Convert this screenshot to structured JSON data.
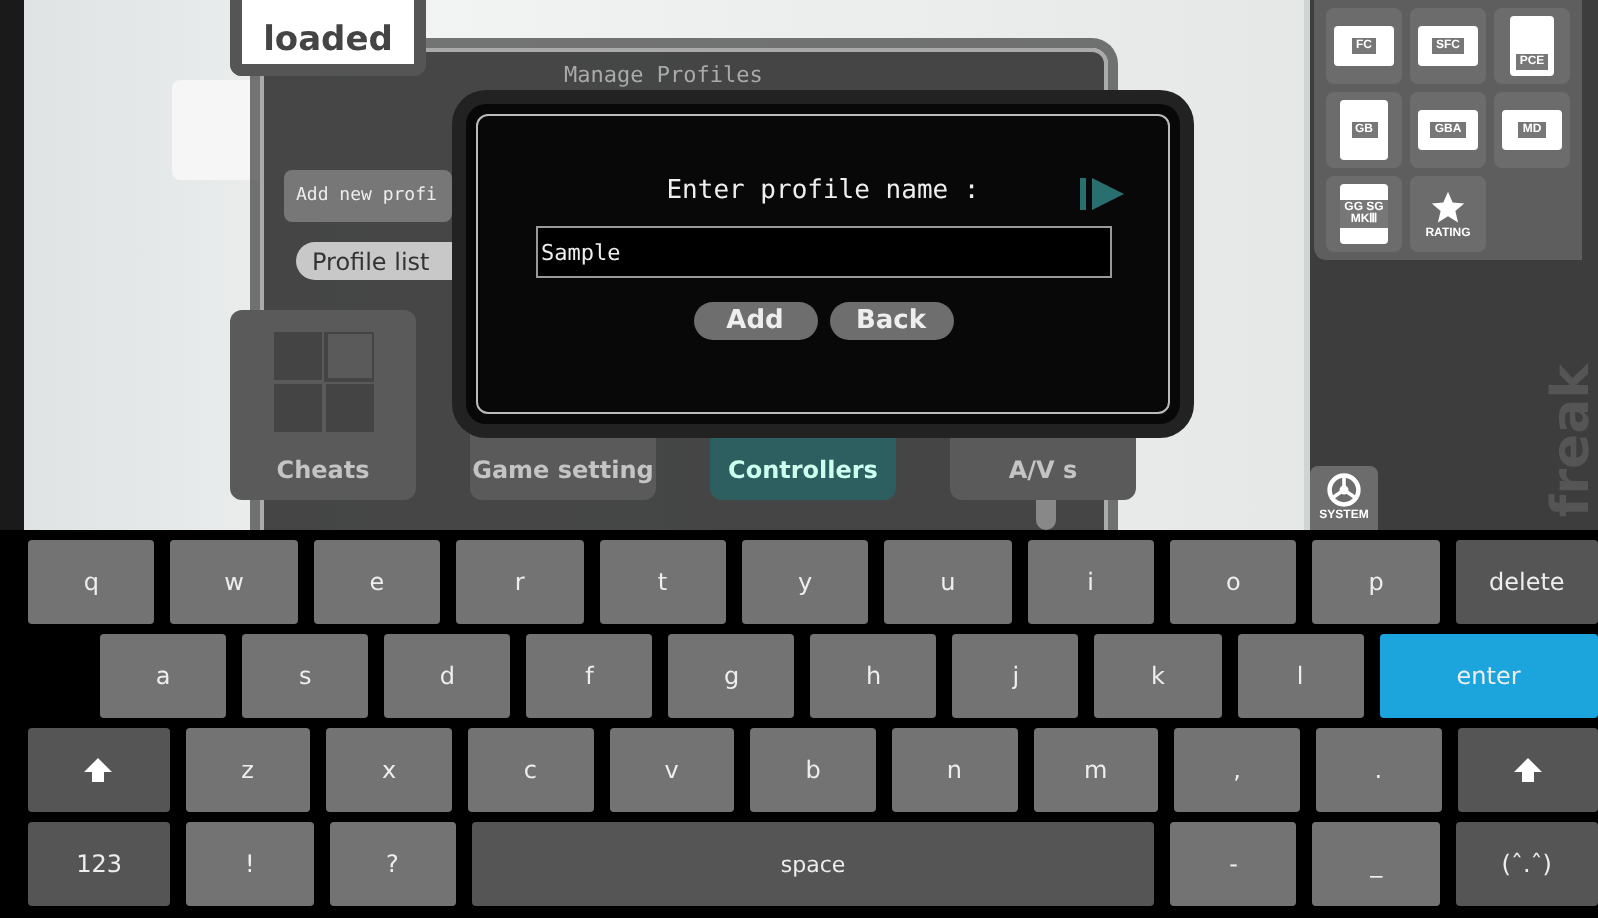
{
  "background": {
    "game_card": "loaded"
  },
  "manage_dialog": {
    "title": "Manage Profiles",
    "add_item": "Add new profi",
    "list_item": "Profile list"
  },
  "tiles": [
    {
      "label": "Cheats",
      "selected": false
    },
    {
      "label": "Game setting",
      "selected": false
    },
    {
      "label": "Controllers",
      "selected": true
    },
    {
      "label": "A/V s",
      "selected": false
    }
  ],
  "prompt": {
    "title": "Enter profile name :",
    "value": "Sample",
    "buttons": [
      "Add",
      "Back"
    ]
  },
  "sidebar": {
    "consoles": [
      {
        "label": "FC",
        "kind": "wide"
      },
      {
        "label": "SFC",
        "kind": "wide"
      },
      {
        "label": "PCE",
        "kind": "card"
      },
      {
        "label": "GB",
        "kind": "tall"
      },
      {
        "label": "GBA",
        "kind": "wide"
      },
      {
        "label": "MD",
        "kind": "wide"
      },
      {
        "label": "GG SG MKⅢ",
        "kind": "tall"
      },
      {
        "label": "RATING",
        "kind": "rating"
      }
    ],
    "system": "SYSTEM",
    "logo": "freak"
  },
  "keyboard": [
    [
      {
        "label": "q",
        "kind": "char"
      },
      {
        "label": "w",
        "kind": "char"
      },
      {
        "label": "e",
        "kind": "char"
      },
      {
        "label": "r",
        "kind": "char"
      },
      {
        "label": "t",
        "kind": "char"
      },
      {
        "label": "y",
        "kind": "char"
      },
      {
        "label": "u",
        "kind": "char"
      },
      {
        "label": "i",
        "kind": "char"
      },
      {
        "label": "o",
        "kind": "char"
      },
      {
        "label": "p",
        "kind": "char"
      },
      {
        "label": "delete",
        "kind": "action"
      }
    ],
    [
      {
        "label": "a",
        "kind": "char"
      },
      {
        "label": "s",
        "kind": "char"
      },
      {
        "label": "d",
        "kind": "char"
      },
      {
        "label": "f",
        "kind": "char"
      },
      {
        "label": "g",
        "kind": "char"
      },
      {
        "label": "h",
        "kind": "char"
      },
      {
        "label": "j",
        "kind": "char"
      },
      {
        "label": "k",
        "kind": "char"
      },
      {
        "label": "l",
        "kind": "char"
      },
      {
        "label": "enter",
        "kind": "enter"
      }
    ],
    [
      {
        "kind": "shift"
      },
      {
        "label": "z",
        "kind": "char"
      },
      {
        "label": "x",
        "kind": "char"
      },
      {
        "label": "c",
        "kind": "char"
      },
      {
        "label": "v",
        "kind": "char"
      },
      {
        "label": "b",
        "kind": "char"
      },
      {
        "label": "n",
        "kind": "char"
      },
      {
        "label": "m",
        "kind": "char"
      },
      {
        "label": ",",
        "kind": "char"
      },
      {
        "label": ".",
        "kind": "char"
      },
      {
        "kind": "shift"
      }
    ],
    [
      {
        "label": "123",
        "kind": "action"
      },
      {
        "label": "!",
        "kind": "char"
      },
      {
        "label": "?",
        "kind": "char"
      },
      {
        "label": "space",
        "kind": "space"
      },
      {
        "label": "-",
        "kind": "char"
      },
      {
        "label": "_",
        "kind": "char"
      },
      {
        "label": "(ˆ.ˆ)",
        "kind": "action"
      }
    ]
  ]
}
